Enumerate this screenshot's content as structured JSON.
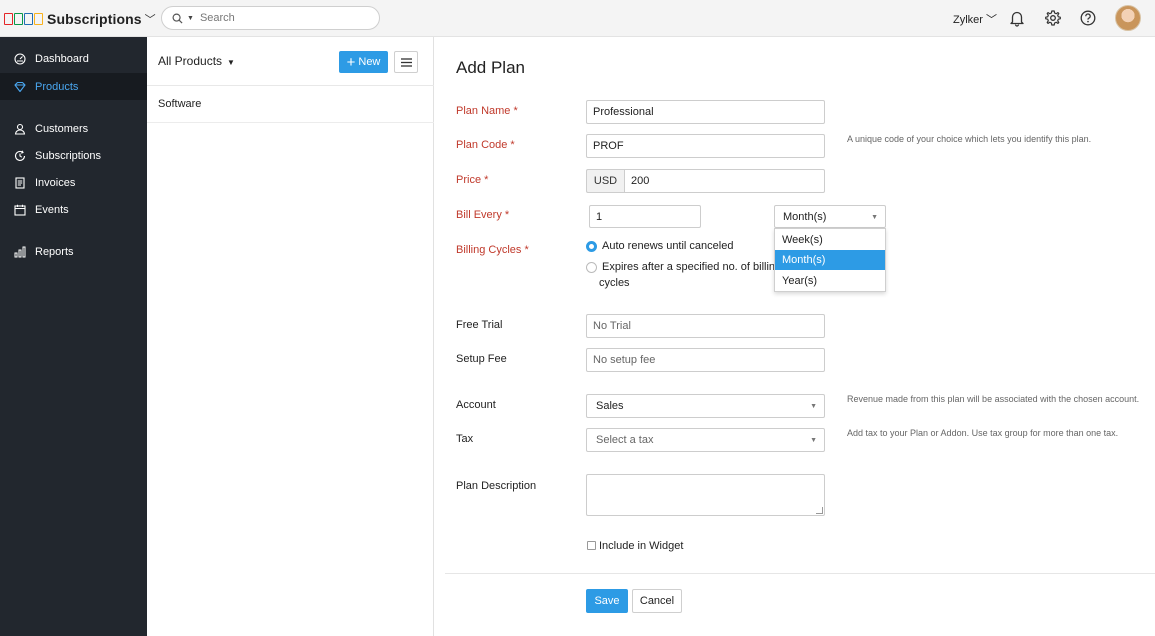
{
  "app": {
    "logo_text": "ZOHO",
    "title": "Subscriptions",
    "org_name": "Zylker"
  },
  "search": {
    "placeholder": "Search"
  },
  "icons": {
    "notifications": "bell-icon",
    "settings": "gear-icon",
    "help": "help-icon",
    "search": "search-icon"
  },
  "sidebar": {
    "items": [
      {
        "label": "Dashboard",
        "icon": "dashboard-icon",
        "active": false
      },
      {
        "label": "Products",
        "icon": "products-icon",
        "active": true
      },
      {
        "label": "Customers",
        "icon": "customers-icon",
        "active": false
      },
      {
        "label": "Subscriptions",
        "icon": "subscriptions-icon",
        "active": false
      },
      {
        "label": "Invoices",
        "icon": "invoices-icon",
        "active": false
      },
      {
        "label": "Events",
        "icon": "events-icon",
        "active": false
      },
      {
        "label": "Reports",
        "icon": "reports-icon",
        "active": false
      }
    ]
  },
  "list": {
    "title": "All Products",
    "new_label": "New",
    "rows": [
      "Software"
    ]
  },
  "form": {
    "title": "Add Plan",
    "plan_name": {
      "label": "Plan Name *",
      "value": "Professional"
    },
    "plan_code": {
      "label": "Plan Code *",
      "value": "PROF",
      "hint": "A unique code of your choice which lets you identify this plan."
    },
    "price": {
      "label": "Price *",
      "currency": "USD",
      "value": "200"
    },
    "bill_every": {
      "label": "Bill Every *",
      "value": "1",
      "unit": "Month(s)",
      "options": [
        "Week(s)",
        "Month(s)",
        "Year(s)"
      ],
      "selected_index": 1
    },
    "billing_cycles": {
      "label": "Billing Cycles *",
      "option_auto": "Auto renews until canceled",
      "option_expire_line1": "Expires after a specified no. of billing",
      "option_expire_line2": "cycles"
    },
    "free_trial": {
      "label": "Free Trial",
      "placeholder": "No Trial"
    },
    "setup_fee": {
      "label": "Setup Fee",
      "placeholder": "No setup fee"
    },
    "account": {
      "label": "Account",
      "value": "Sales",
      "hint": "Revenue made from this plan will be associated with the chosen account."
    },
    "tax": {
      "label": "Tax",
      "placeholder": "Select a tax",
      "hint": "Add tax to your Plan or Addon. Use tax group for more than one tax."
    },
    "description": {
      "label": "Plan Description"
    },
    "widget": {
      "label": "Include in Widget"
    },
    "save_label": "Save",
    "cancel_label": "Cancel"
  },
  "colors": {
    "accent": "#2d9be5",
    "sidebar_bg": "#22272e",
    "required": "#c0392b"
  }
}
